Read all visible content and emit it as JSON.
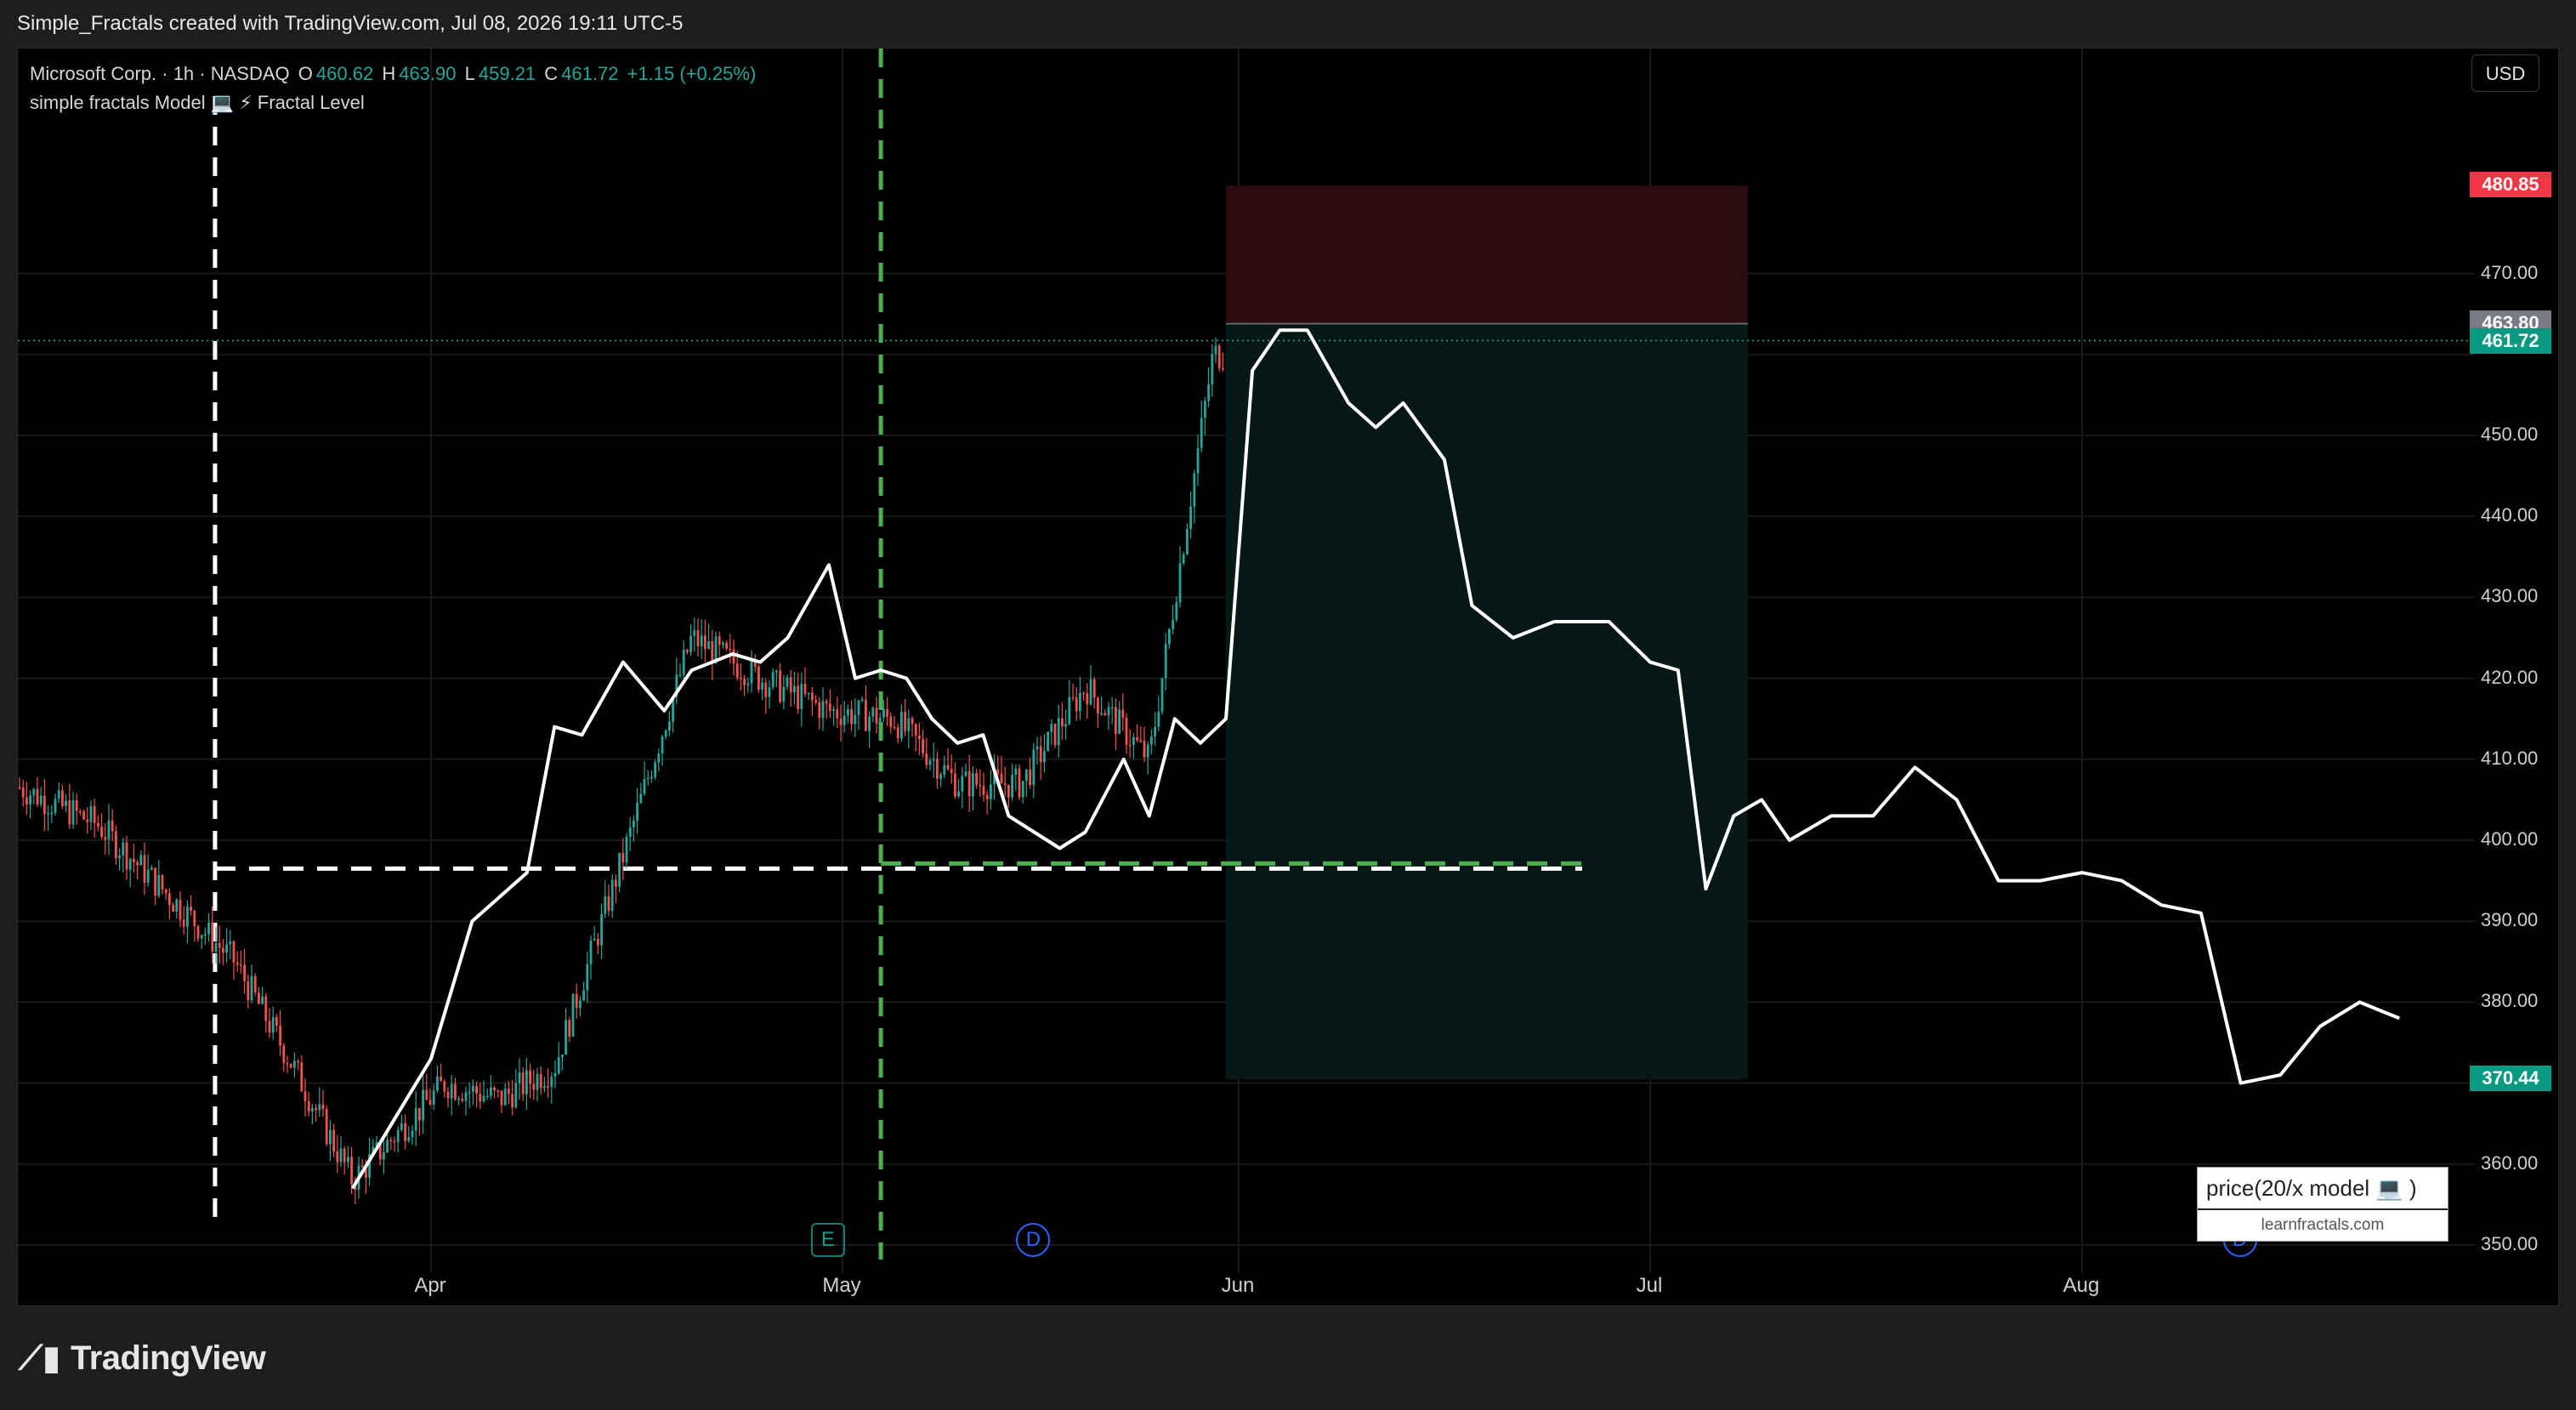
{
  "header": {
    "text": "Simple_Fractals created with TradingView.com, Jul 08, 2026 19:11 UTC-5"
  },
  "legend": {
    "symbol": "Microsoft Corp. · 1h · NASDAQ",
    "o_label": "O",
    "o_value": "460.62",
    "h_label": "H",
    "h_value": "463.90",
    "l_label": "L",
    "l_value": "459.21",
    "c_label": "C",
    "c_value": "461.72",
    "change": "+1.15 (+0.25%)",
    "indicator": "simple fractals Model 💻 ⚡ Fractal Level"
  },
  "currency_button": "USD",
  "price_tags": {
    "stop": "480.85",
    "entry": "463.80",
    "last": "461.72",
    "target": "370.44"
  },
  "axis": {
    "price_labels": [
      "470.00",
      "450.00",
      "440.00",
      "430.00",
      "420.00",
      "410.00",
      "400.00",
      "390.00",
      "380.00",
      "360.00",
      "350.00"
    ],
    "date_labels": [
      "Apr",
      "May",
      "Jun",
      "Jul",
      "Aug"
    ]
  },
  "events": {
    "earnings": "E",
    "dividend1": "D",
    "dividend2": "D"
  },
  "model_box": {
    "title": "price(20/x model 💻 )",
    "url": "learnfractals.com"
  },
  "footer": {
    "brand": "TradingView"
  },
  "colors": {
    "background": "#000000",
    "up": "#26a69a",
    "down": "#ef5350",
    "stop_zone": "#2b0d10",
    "target_zone": "#051816",
    "stop_tag": "#f23645",
    "entry_tag": "#787b86",
    "target_tag": "#089981",
    "projection": "#ffffff",
    "green_dash": "#4caf50"
  },
  "chart_data": {
    "type": "line",
    "title": "",
    "ylim": [
      343,
      488
    ],
    "price_unit": "USD",
    "series": [
      {
        "name": "",
        "x": [
          "03-01",
          "03-08",
          "03-15",
          "03-22",
          "03-25",
          "03-28",
          "04-02",
          "04-06",
          "04-10",
          "04-15",
          "04-20",
          "04-25",
          "04-30",
          "05-05",
          "05-10",
          "05-15",
          "05-20",
          "05-25",
          "05-30"
        ],
        "values": [
          402,
          410,
          402,
          385,
          372,
          358,
          370,
          368,
          372,
          398,
          425,
          420,
          416,
          415,
          407,
          407,
          419,
          410,
          460
        ]
      },
      {
        "name": "",
        "x": [
          "03-28",
          "04-01",
          "04-04",
          "04-08",
          "04-10",
          "04-12",
          "04-15",
          "04-18",
          "04-20",
          "04-23",
          "04-25",
          "04-27",
          "04-30",
          "05-02",
          "05-04",
          "05-06",
          "05-08",
          "05-10",
          "05-12",
          "05-14",
          "05-16",
          "05-18",
          "05-20",
          "05-23",
          "05-25",
          "05-27",
          "05-29",
          "05-31",
          "06-02",
          "06-04",
          "06-06",
          "06-09",
          "06-11",
          "06-13",
          "06-16",
          "06-18",
          "06-21",
          "06-24",
          "06-26",
          "06-28",
          "07-01",
          "07-03",
          "07-05",
          "07-07",
          "07-09",
          "07-11",
          "07-14",
          "07-17",
          "07-20",
          "07-23",
          "07-26",
          "07-29",
          "08-01",
          "08-04",
          "08-07",
          "08-10",
          "08-13",
          "08-16",
          "08-19",
          "08-22",
          "08-25"
        ],
        "values": [
          357,
          373,
          390,
          396,
          414,
          413,
          422,
          416,
          421,
          423,
          422,
          425,
          434,
          420,
          421,
          420,
          415,
          412,
          413,
          403,
          401,
          399,
          401,
          410,
          403,
          415,
          412,
          415,
          458,
          463,
          463,
          454,
          451,
          454,
          447,
          429,
          425,
          427,
          427,
          427,
          422,
          421,
          394,
          403,
          405,
          400,
          403,
          403,
          409,
          405,
          395,
          395,
          396,
          395,
          392,
          391,
          370,
          371,
          377,
          380,
          378
        ]
      }
    ],
    "zones": {
      "stop": {
        "from": 463.8,
        "to": 480.85
      },
      "target": {
        "from": 370.44,
        "to": 463.8
      },
      "start_date": "05-31",
      "end_date": "07-08"
    },
    "reference": {
      "horizontal_level": 396.5,
      "vertical_dates": [
        "03-21",
        "05-04"
      ]
    },
    "events": [
      {
        "label": "E",
        "date": "04-30"
      },
      {
        "label": "D",
        "date": "05-16"
      },
      {
        "label": "D",
        "date": "08-13"
      }
    ]
  }
}
